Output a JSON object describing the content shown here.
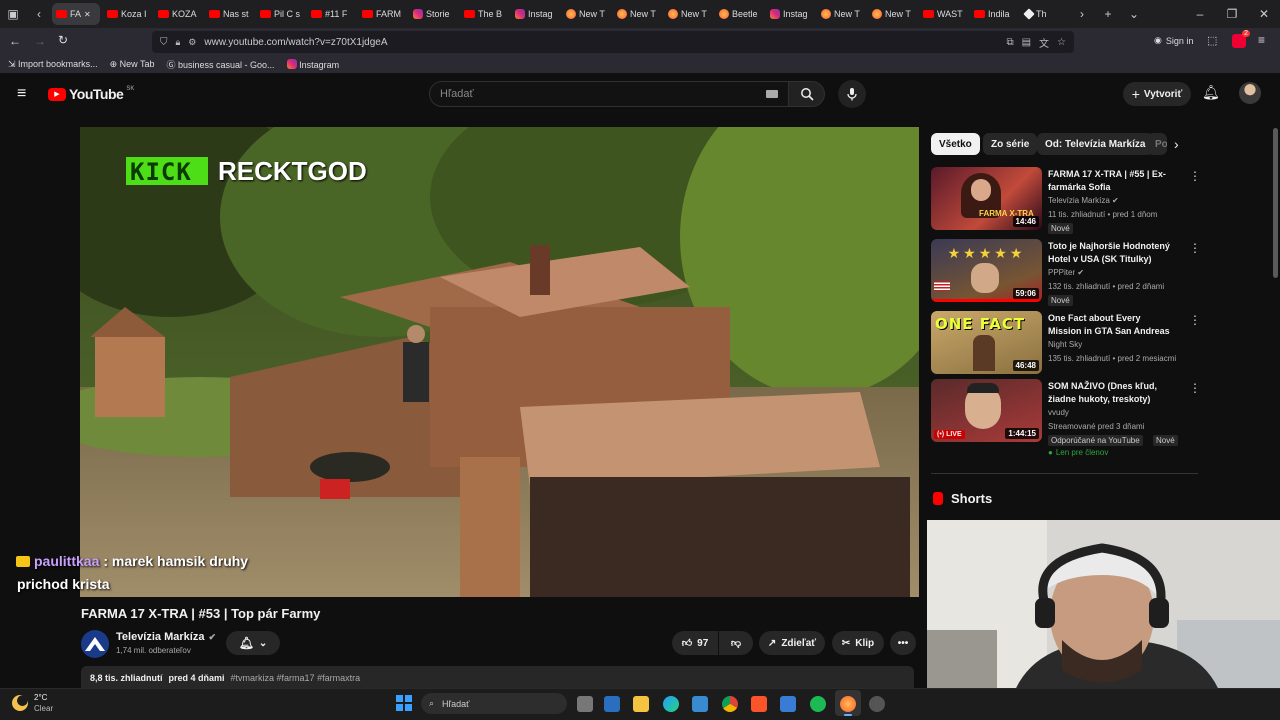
{
  "browser": {
    "tabs": [
      {
        "label": "FA",
        "type": "yt",
        "active": true
      },
      {
        "label": "Koza I",
        "type": "yt"
      },
      {
        "label": "KOZA",
        "type": "yt"
      },
      {
        "label": "Nas st",
        "type": "yt"
      },
      {
        "label": "Pil C s",
        "type": "yt"
      },
      {
        "label": "#11 F",
        "type": "yt"
      },
      {
        "label": "FARM",
        "type": "yt"
      },
      {
        "label": "Storie",
        "type": "ig"
      },
      {
        "label": "The B",
        "type": "yt"
      },
      {
        "label": "Instag",
        "type": "ig"
      },
      {
        "label": "New T",
        "type": "ff"
      },
      {
        "label": "New T",
        "type": "ff"
      },
      {
        "label": "New T",
        "type": "ff"
      },
      {
        "label": "Beetle",
        "type": "ff"
      },
      {
        "label": "Instag",
        "type": "ig"
      },
      {
        "label": "New T",
        "type": "ff"
      },
      {
        "label": "New T",
        "type": "ff"
      },
      {
        "label": "WAST",
        "type": "yt"
      },
      {
        "label": "Indila",
        "type": "yt"
      },
      {
        "label": "Th",
        "type": "wh"
      }
    ],
    "url": "www.youtube.com/watch?v=z70tX1jdgeA",
    "signin_label": "Sign in",
    "ext_badge": "2",
    "bookmarks": [
      "Import bookmarks...",
      "New Tab",
      "business casual - Goo...",
      "Instagram"
    ]
  },
  "youtube": {
    "logo_text": "YouTube",
    "region": "SK",
    "search_placeholder": "Hľadať",
    "create_label": "Vytvoriť",
    "chips": [
      "Všetko",
      "Zo série",
      "Od: Televízia Markíza",
      "Po"
    ],
    "video": {
      "overlay_brand": "KICK",
      "overlay_name": "RECKTGOD",
      "title": "FARMA 17 X-TRA | #53 | Top pár Farmy",
      "channel": "Televízia Markíza",
      "subscribers": "1,74 mil. odberateľov",
      "likes": "97",
      "share_label": "Zdieľať",
      "clip_label": "Klip",
      "views": "8,8 tis. zhliadnutí",
      "age": "pred 4 dňami",
      "hashtags": "#tvmarkiza #farma17 #farmaxtra"
    },
    "chat": {
      "user": "paulittkaa",
      "message": ": marek hamsik druhy",
      "message2": "prichod krista"
    },
    "recommendations": [
      {
        "title": "FARMA 17 X-TRA | #55 | Ex-farmárka Sofia",
        "channel": "Televízia Markíza",
        "meta": "11 tis. zhliadnutí • pred 1 dňom",
        "duration": "14:46",
        "badges": [
          "Nové"
        ],
        "thumb_text": "FARMA X-TRA",
        "verified": true
      },
      {
        "title": "Toto je Najhoršie Hodnotený Hotel v USA (SK Titulky)",
        "channel": "PPPiter",
        "meta": "132 tis. zhliadnutí • pred 2 dňami",
        "duration": "59:06",
        "badges": [
          "Nové"
        ],
        "verified": true
      },
      {
        "title": "One Fact about Every Mission in GTA San Andreas",
        "channel": "Night Sky",
        "meta": "135 tis. zhliadnutí • pred 2 mesiacmi",
        "duration": "46:48",
        "thumb_text": "ONE FACT",
        "verified": false
      },
      {
        "title": "SOM NAŽIVO (Dnes kľud, žiadne hukoty, treskoty)",
        "channel": "vvudy",
        "meta": "Streamované pred 3 dňami",
        "duration": "1:44:15",
        "badges": [
          "Odporúčané na YouTube",
          "Nové"
        ],
        "members": "Len pre členov",
        "live": "LIVE",
        "verified": false
      }
    ],
    "shorts_label": "Shorts"
  },
  "taskbar": {
    "weather_temp": "2°C",
    "weather_desc": "Clear",
    "search_placeholder": "Hľadať"
  }
}
